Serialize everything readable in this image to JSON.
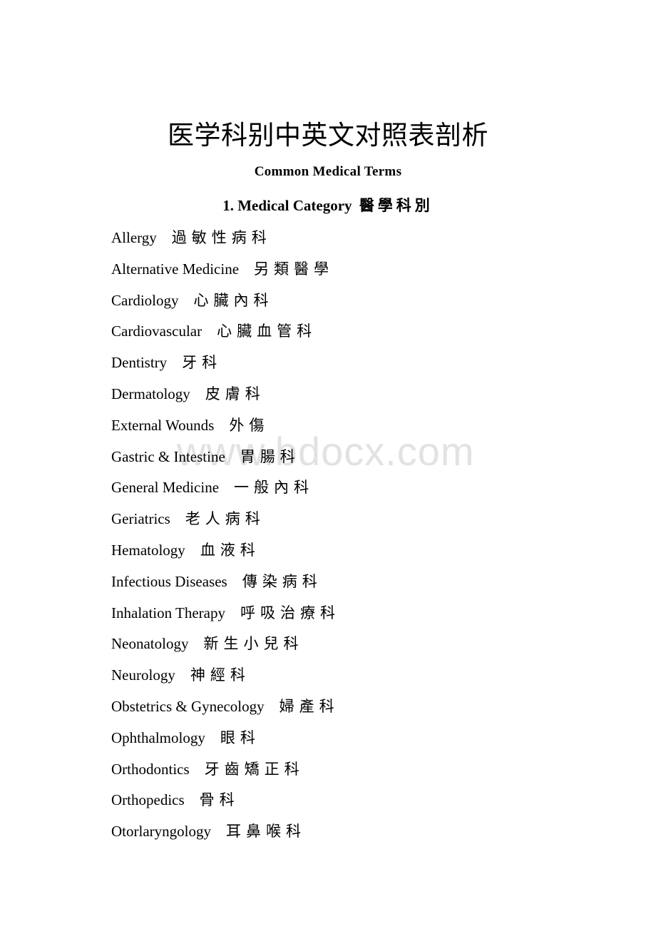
{
  "document": {
    "title": "医学科别中英文对照表剖析",
    "subtitle": "Common Medical Terms",
    "section_number_and_title": "1. Medical Category",
    "section_title_cn": "醫學科別",
    "watermark": "www.bdocx.com",
    "background_color": "#ffffff",
    "text_color": "#000000",
    "watermark_color": "#e2e2e2"
  },
  "terms": [
    {
      "en": "Allergy",
      "cn": "過敏性病科"
    },
    {
      "en": "Alternative Medicine",
      "cn": "另類醫學"
    },
    {
      "en": "Cardiology",
      "cn": "心臟內科"
    },
    {
      "en": "Cardiovascular",
      "cn": "心臟血管科"
    },
    {
      "en": "Dentistry",
      "cn": "牙科"
    },
    {
      "en": "Dermatology",
      "cn": "皮膚科"
    },
    {
      "en": "External Wounds",
      "cn": "外傷"
    },
    {
      "en": "Gastric & Intestine",
      "cn": "胃腸科"
    },
    {
      "en": "General Medicine",
      "cn": "一般內科"
    },
    {
      "en": "Geriatrics",
      "cn": "老人病科"
    },
    {
      "en": "Hematology",
      "cn": "血液科"
    },
    {
      "en": "Infectious Diseases",
      "cn": "傳染病科"
    },
    {
      "en": "Inhalation Therapy",
      "cn": "呼吸治療科"
    },
    {
      "en": "Neonatology",
      "cn": "新生小兒科"
    },
    {
      "en": "Neurology",
      "cn": "神經科"
    },
    {
      "en": "Obstetrics & Gynecology",
      "cn": "婦產科"
    },
    {
      "en": "Ophthalmology",
      "cn": "眼科"
    },
    {
      "en": "Orthodontics",
      "cn": "牙齒矯正科"
    },
    {
      "en": "Orthopedics",
      "cn": "骨科"
    },
    {
      "en": "Otorlaryngology",
      "cn": "耳鼻喉科"
    }
  ]
}
